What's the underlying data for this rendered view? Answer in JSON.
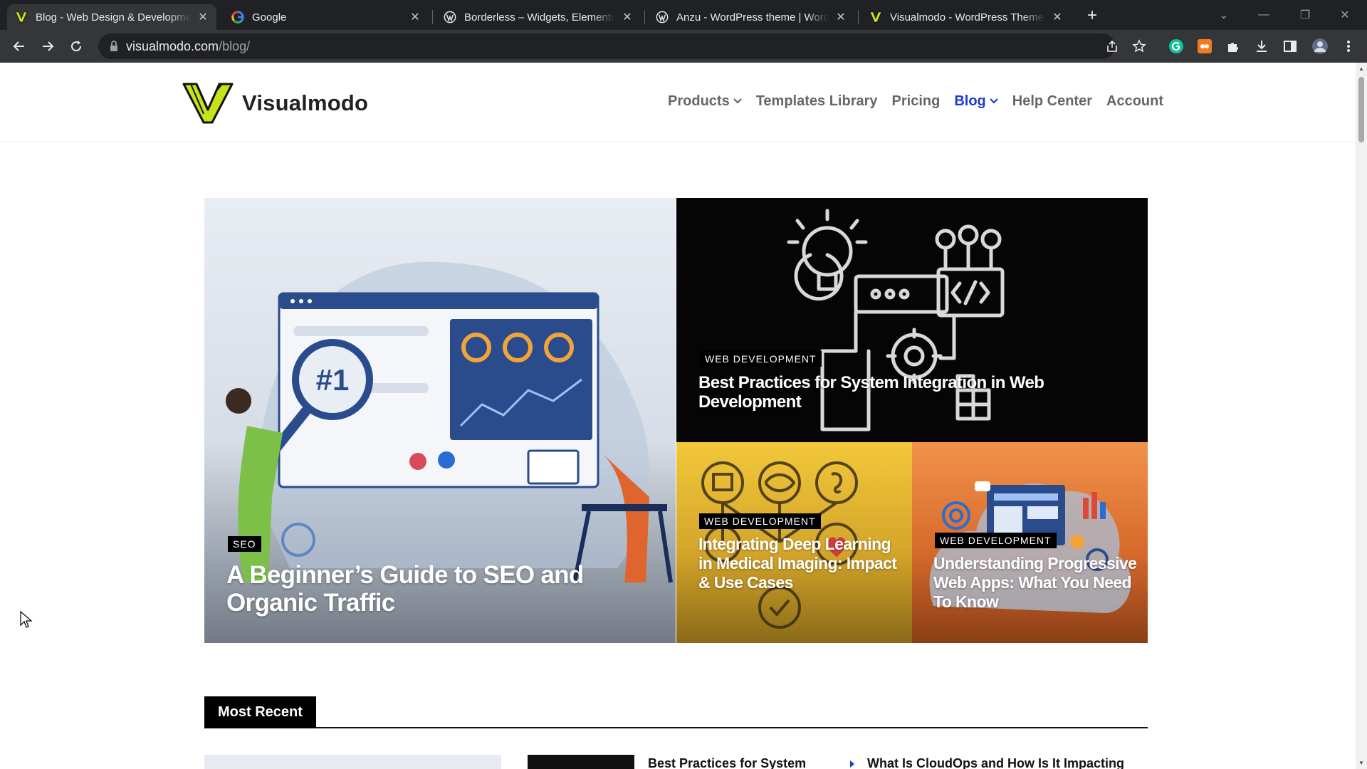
{
  "browser": {
    "tabs": [
      {
        "title": "Blog - Web Design & Development",
        "active": true,
        "favicon": "visualmodo-icon"
      },
      {
        "title": "Google",
        "active": false,
        "favicon": "google-icon"
      },
      {
        "title": "Borderless – Widgets, Elements, T",
        "active": false,
        "favicon": "wordpress-icon"
      },
      {
        "title": "Anzu - WordPress theme | WordP",
        "active": false,
        "favicon": "wordpress-icon"
      },
      {
        "title": "Visualmodo - WordPress Themes",
        "active": false,
        "favicon": "visualmodo-icon"
      }
    ],
    "url_host": "visualmodo.com",
    "url_path": "/blog/"
  },
  "site": {
    "logo_text": "Visualmodo",
    "brand_color": "#c8e21a",
    "accent_color": "#1a3bd8",
    "nav": [
      {
        "label": "Products",
        "dropdown": true,
        "active": false
      },
      {
        "label": "Templates Library",
        "dropdown": false,
        "active": false
      },
      {
        "label": "Pricing",
        "dropdown": false,
        "active": false
      },
      {
        "label": "Blog",
        "dropdown": true,
        "active": true
      },
      {
        "label": "Help Center",
        "dropdown": false,
        "active": false
      },
      {
        "label": "Account",
        "dropdown": false,
        "active": false
      }
    ]
  },
  "hero": {
    "main": {
      "category": "SEO",
      "title": "A Beginner’s Guide to SEO and Organic Traffic"
    },
    "dev": {
      "category": "WEB DEVELOPMENT",
      "title": "Best Practices for System Integration in Web Development"
    },
    "med": {
      "category": "WEB DEVELOPMENT",
      "title": "Integrating Deep Learning in Medical Imaging: Impact & Use Cases"
    },
    "pwa": {
      "category": "WEB DEVELOPMENT",
      "title": "Understanding Progressive Web Apps: What You Need To Know"
    }
  },
  "recent": {
    "heading": "Most Recent",
    "item1_title": "Best Practices for System",
    "item2_title": "What Is CloudOps and How Is It Impacting"
  }
}
